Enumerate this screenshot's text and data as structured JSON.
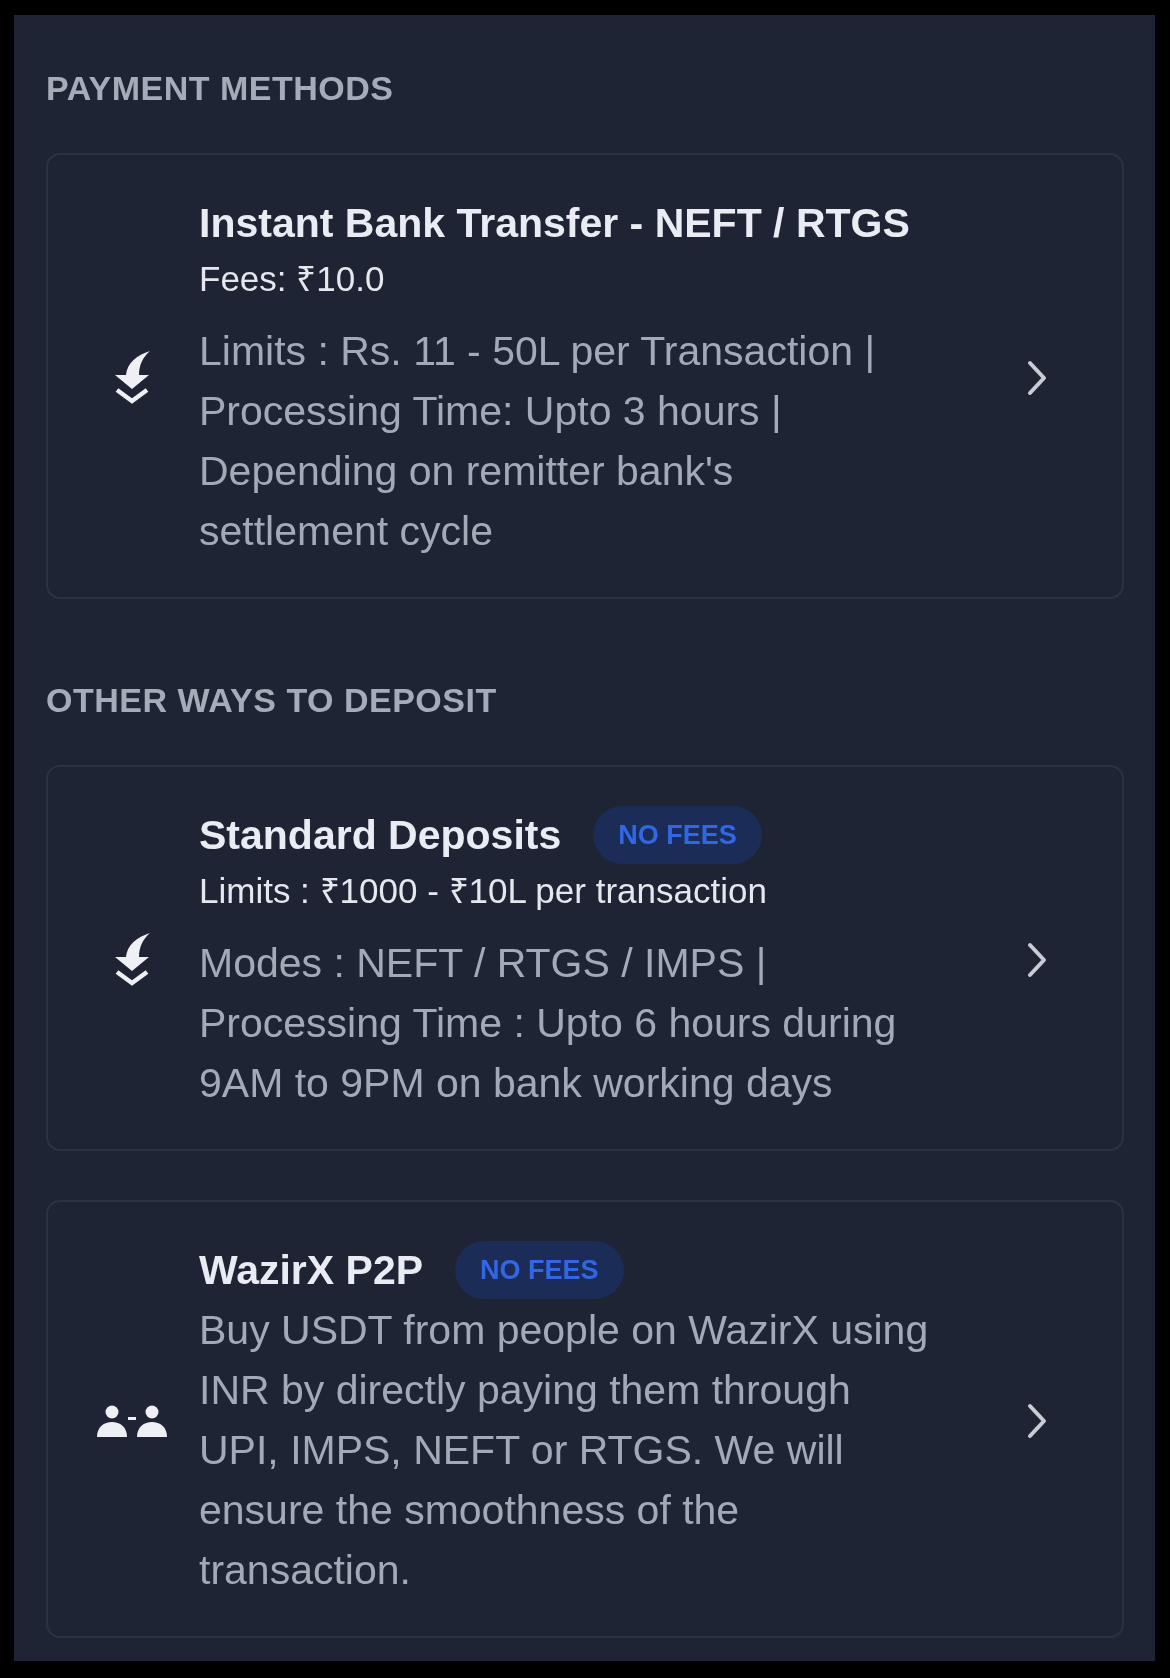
{
  "sections": [
    {
      "heading": "PAYMENT METHODS",
      "methods": [
        {
          "kind": "bank",
          "title": "Instant Bank Transfer - NEFT / RTGS",
          "subtitle": "Fees: ₹10.0",
          "description": "Limits : Rs. 11 - 50L per Transaction | Processing Time: Upto 3 hours | Depending on remitter bank's settlement cycle"
        }
      ]
    },
    {
      "heading": "OTHER WAYS TO DEPOSIT",
      "methods": [
        {
          "kind": "bank",
          "title": "Standard Deposits",
          "badge": "NO FEES",
          "subtitle": "Limits : ₹1000 - ₹10L per transaction",
          "description": "Modes : NEFT / RTGS / IMPS | Processing Time : Upto 6 hours during 9AM to 9PM on bank working days"
        },
        {
          "kind": "p2p",
          "title": "WazirX P2P",
          "badge": "NO FEES",
          "description": "Buy USDT from people on WazirX using INR by directly paying them through UPI, IMPS, NEFT or RTGS. We will ensure the smoothness of the transaction."
        }
      ]
    }
  ]
}
